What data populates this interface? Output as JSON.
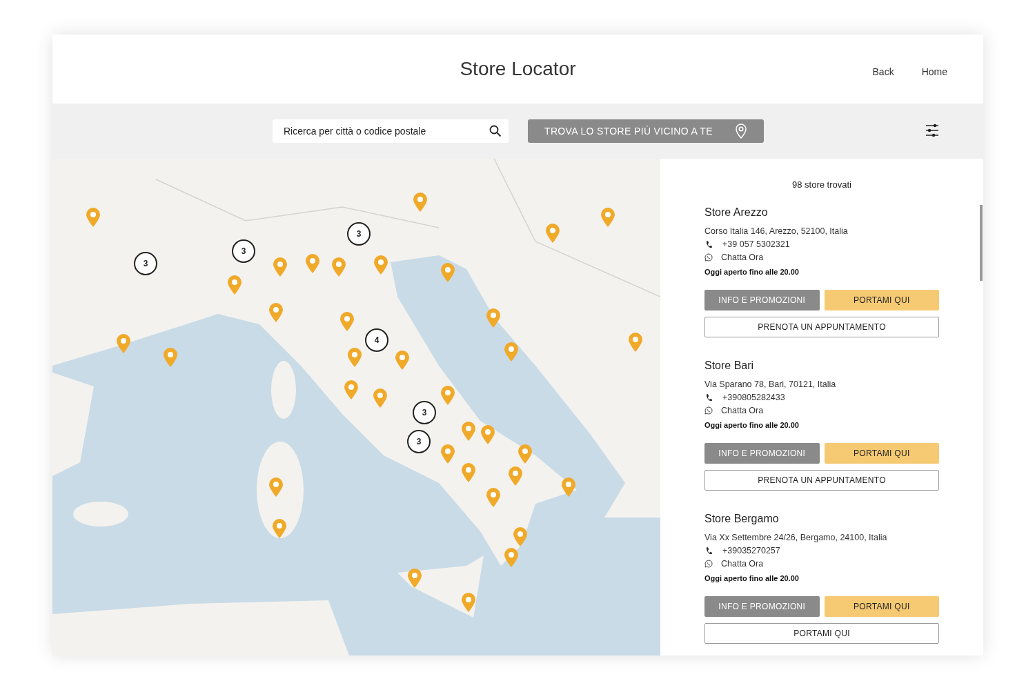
{
  "header": {
    "title": "Store Locator",
    "links": [
      "Back",
      "Home"
    ]
  },
  "search": {
    "placeholder": "Ricerca per città o codice postale"
  },
  "locate_button": {
    "label": "TROVA LO STORE PIÙ VICINO A TE"
  },
  "map": {
    "kind": "picture",
    "clusters": [
      {
        "count": "3"
      },
      {
        "count": "3"
      },
      {
        "count": "3"
      },
      {
        "count": "4"
      },
      {
        "count": "3"
      },
      {
        "count": "3"
      }
    ]
  },
  "results": {
    "count_text": "98 store trovati",
    "stores": [
      {
        "name": "Store Arezzo",
        "address": "Corso Italia 146, Arezzo, 52100, Italia",
        "phone": "+39 057 5302321",
        "chat": "Chatta Ora",
        "hours": "Oggi aperto fino alle 20.00",
        "buttons": [
          {
            "label": "INFO E PROMOZIONI",
            "kind": "secondary"
          },
          {
            "label": "PORTAMI QUI",
            "kind": "primary"
          },
          {
            "label": "PRENOTA UN APPUNTAMENTO",
            "kind": "outline"
          }
        ]
      },
      {
        "name": "Store Bari",
        "address": "Via Sparano 78, Bari, 70121, Italia",
        "phone": "+390805282433",
        "chat": "Chatta Ora",
        "hours": "Oggi aperto fino alle 20.00",
        "buttons": [
          {
            "label": "INFO E PROMOZIONI",
            "kind": "secondary"
          },
          {
            "label": "PORTAMI QUI",
            "kind": "primary"
          },
          {
            "label": "PRENOTA UN APPUNTAMENTO",
            "kind": "outline"
          }
        ]
      },
      {
        "name": "Store Bergamo",
        "address": "Via Xx Settembre 24/26, Bergamo, 24100, Italia",
        "phone": "+39035270257",
        "chat": "Chatta Ora",
        "hours": "Oggi aperto fino alle 20.00",
        "buttons": [
          {
            "label": "INFO E PROMOZIONI",
            "kind": "secondary"
          },
          {
            "label": "PORTAMI QUI",
            "kind": "primary"
          },
          {
            "label": "PORTAMI QUI",
            "kind": "outline"
          }
        ]
      }
    ]
  }
}
